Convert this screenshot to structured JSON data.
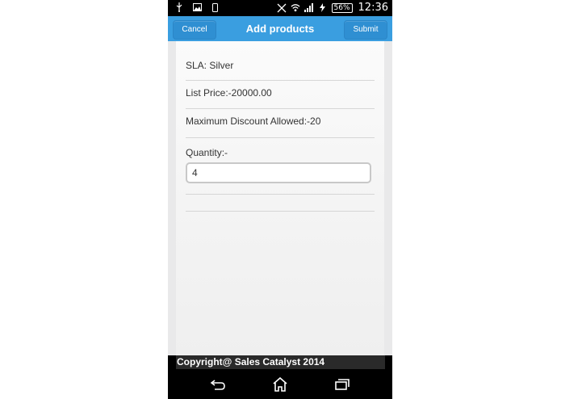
{
  "status_bar": {
    "battery_percent": "56%",
    "time": "12:36",
    "icons": [
      "usb-icon",
      "image-icon",
      "phone-icon",
      "no-signal-icon",
      "wifi-icon",
      "signal-bars-icon",
      "charging-icon"
    ]
  },
  "app_bar": {
    "title": "Add products",
    "cancel_label": "Cancel",
    "submit_label": "Submit",
    "accent_color": "#3a9ee0"
  },
  "details": {
    "sla": "SLA: Silver",
    "list_price": "List Price:-20000.00",
    "max_discount": "Maximum Discount Allowed:-20",
    "quantity_label": "Quantity:-",
    "quantity_value": "4"
  },
  "footer": {
    "copyright": "Copyright@ Sales Catalyst 2014"
  },
  "nav_bar": {
    "buttons": [
      "back-icon",
      "home-icon",
      "recent-apps-icon"
    ]
  }
}
